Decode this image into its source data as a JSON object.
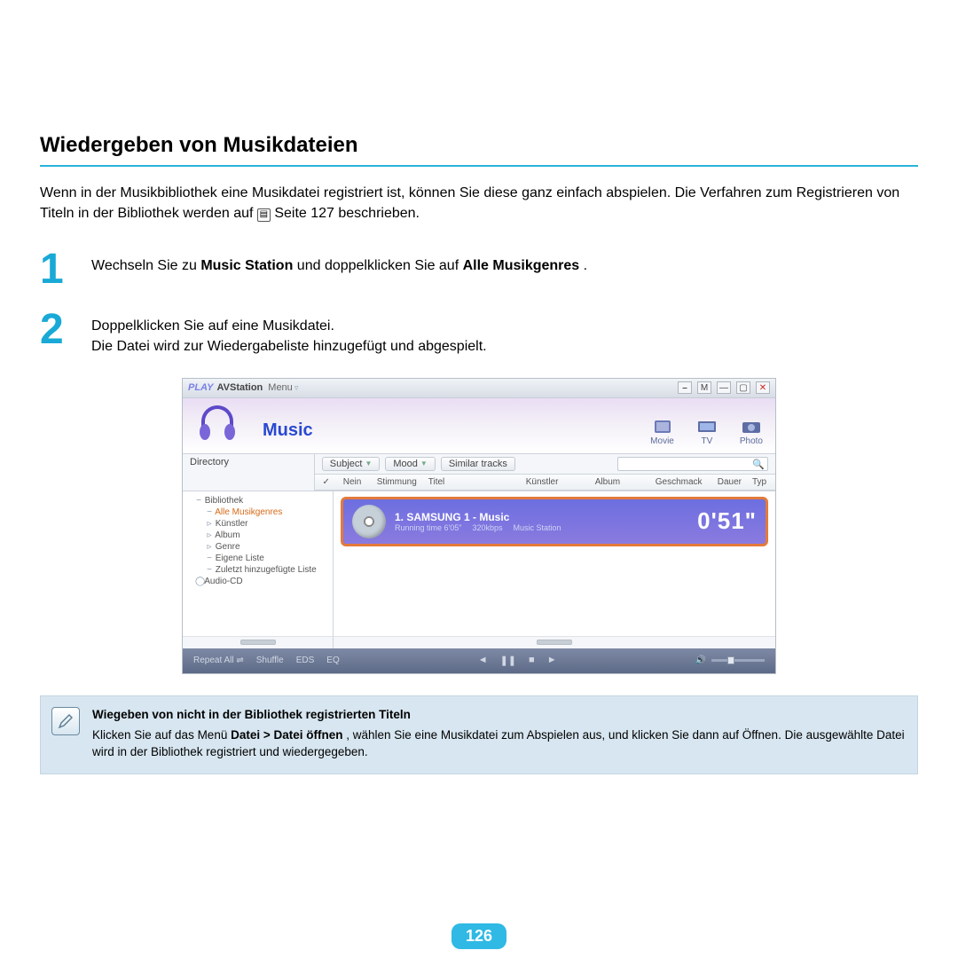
{
  "section_title": "Wiedergeben von Musikdateien",
  "intro": {
    "part1": "Wenn in der Musikbibliothek eine Musikdatei registriert ist, können Sie diese ganz einfach abspielen. Die Verfahren zum Registrieren von Titeln in der Bibliothek werden auf ",
    "part2": " Seite 127 beschrieben."
  },
  "steps": [
    {
      "num": "1",
      "before": "Wechseln Sie zu ",
      "b1": "Music Station",
      "mid": " und doppelklicken Sie auf ",
      "b2": "Alle Musikgenres",
      "after": "."
    },
    {
      "num": "2",
      "line1": "Doppelklicken Sie auf eine Musikdatei.",
      "line2": "Die Datei wird zur Wiedergabeliste hinzugefügt und abgespielt."
    }
  ],
  "app": {
    "titlebar": {
      "play": "PLAY",
      "title": "AVStation",
      "menu": "Menu"
    },
    "header": {
      "music": "Music",
      "modes": [
        "Movie",
        "TV",
        "Photo"
      ]
    },
    "dir_label": "Directory",
    "chips": [
      "Subject",
      "Mood",
      "Similar tracks"
    ],
    "col_headers": [
      "✓",
      "Nein",
      "Stimmung",
      "Titel",
      "Künstler",
      "Album",
      "Geschmack",
      "Dauer",
      "Typ"
    ],
    "tree": [
      {
        "label": "Bibliothek",
        "lv": 1,
        "exp": "−",
        "active": false
      },
      {
        "label": "Alle Musikgenres",
        "lv": 2,
        "exp": "−",
        "active": true
      },
      {
        "label": "Künstler",
        "lv": 2,
        "exp": "▹",
        "active": false
      },
      {
        "label": "Album",
        "lv": 2,
        "exp": "▹",
        "active": false
      },
      {
        "label": "Genre",
        "lv": 2,
        "exp": "▹",
        "active": false
      },
      {
        "label": "Eigene Liste",
        "lv": 2,
        "exp": "−",
        "active": false
      },
      {
        "label": "Zuletzt hinzugefügte Liste",
        "lv": 2,
        "exp": "−",
        "active": false
      },
      {
        "label": "Audio-CD",
        "lv": 1,
        "exp": "◯",
        "active": false
      }
    ],
    "now_playing": {
      "title": "1.  SAMSUNG 1 - Music",
      "running": "Running time 6'05\"",
      "bitrate": "320kbps",
      "source": "Music Station",
      "time": "0'51\""
    },
    "player": {
      "left": [
        "Repeat All",
        "Shuffle",
        "EDS",
        "EQ"
      ],
      "center_icons": [
        "◄",
        "❚❚",
        "■",
        "►"
      ]
    }
  },
  "note": {
    "title": "Wiegeben von nicht in der Bibliothek registrierten Titeln",
    "pre": "Klicken Sie auf das Menü ",
    "bold": "Datei > Datei öffnen",
    "post": ", wählen Sie eine Musikdatei zum Abspielen aus, und klicken Sie dann auf Öffnen. Die ausgewählte Datei wird in der Bibliothek registriert und wiedergegeben."
  },
  "page_number": "126"
}
